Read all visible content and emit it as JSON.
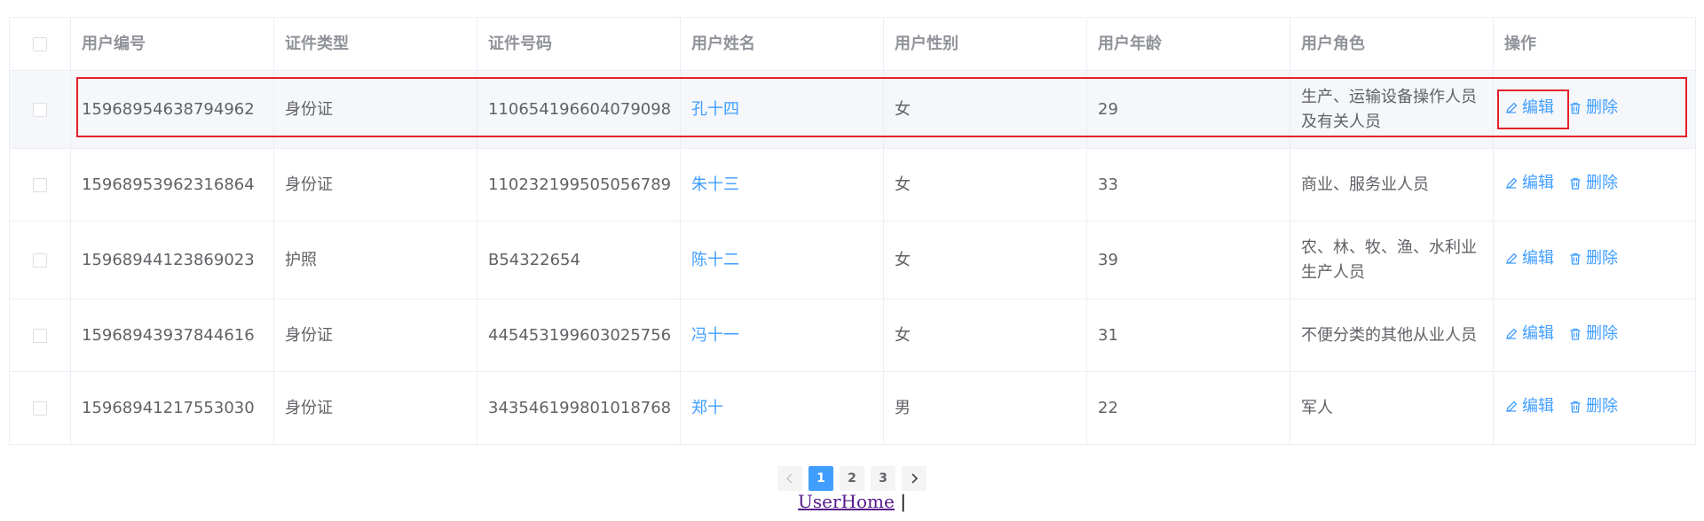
{
  "table": {
    "headers": [
      "用户编号",
      "证件类型",
      "证件号码",
      "用户姓名",
      "用户性别",
      "用户年龄",
      "用户角色",
      "操作"
    ],
    "rows": [
      {
        "id": "15968954638794962",
        "doc_type": "身份证",
        "doc_no": "110654196604079098",
        "name": "孔十四",
        "gender": "女",
        "age": "29",
        "role": "生产、运输设备操作人员及有关人员"
      },
      {
        "id": "15968953962316864",
        "doc_type": "身份证",
        "doc_no": "110232199505056789",
        "name": "朱十三",
        "gender": "女",
        "age": "33",
        "role": "商业、服务业人员"
      },
      {
        "id": "15968944123869023",
        "doc_type": "护照",
        "doc_no": "B54322654",
        "name": "陈十二",
        "gender": "女",
        "age": "39",
        "role": "农、林、牧、渔、水利业生产人员"
      },
      {
        "id": "15968943937844616",
        "doc_type": "身份证",
        "doc_no": "445453199603025756",
        "name": "冯十一",
        "gender": "女",
        "age": "31",
        "role": "不便分类的其他从业人员"
      },
      {
        "id": "15968941217553030",
        "doc_type": "身份证",
        "doc_no": "343546199801018768",
        "name": "郑十",
        "gender": "男",
        "age": "22",
        "role": "军人"
      }
    ],
    "edit_label": "编辑",
    "delete_label": "删除"
  },
  "pagination": {
    "pages": [
      "1",
      "2",
      "3"
    ],
    "prev_icon": "chevron-left-icon",
    "next_icon": "chevron-right-icon"
  },
  "footer": {
    "link": "UserHome",
    "separator": "|"
  },
  "colors": {
    "accent": "#409eff",
    "highlight": "#e6212a",
    "border": "#ebeef5"
  }
}
